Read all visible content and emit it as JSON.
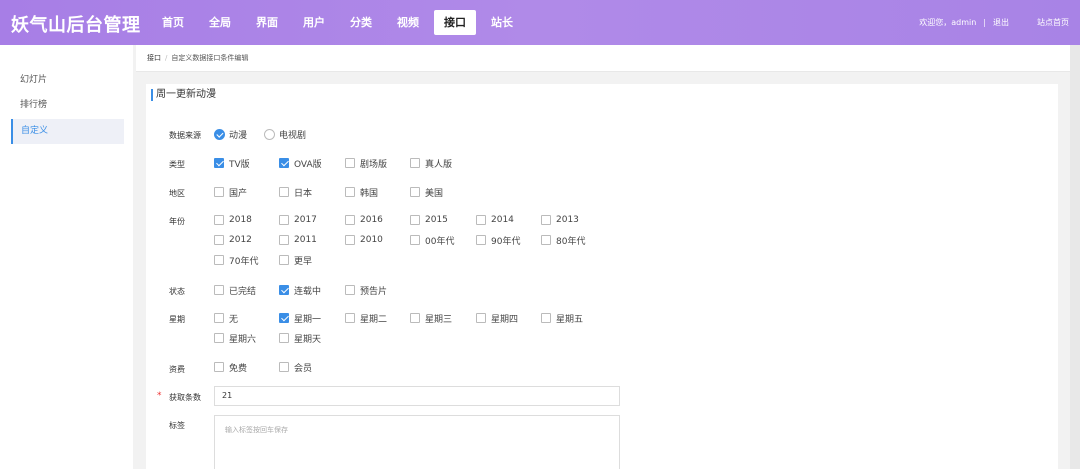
{
  "app": {
    "title": "妖气山后台管理"
  },
  "nav": [
    {
      "label": "首页"
    },
    {
      "label": "全局"
    },
    {
      "label": "界面"
    },
    {
      "label": "用户"
    },
    {
      "label": "分类"
    },
    {
      "label": "视频"
    },
    {
      "label": "接口",
      "active": true
    },
    {
      "label": "站长"
    }
  ],
  "top_right": {
    "welcome": "欢迎您，admin",
    "separator": "|",
    "logout": "退出",
    "site_home": "站点首页"
  },
  "sidebar": {
    "items": [
      {
        "label": "幻灯片"
      },
      {
        "label": "排行榜"
      },
      {
        "label": "自定义",
        "active": true
      }
    ]
  },
  "breadcrumb": {
    "root": "接口",
    "separator": "/",
    "current": "自定义数据接口条件编辑"
  },
  "card": {
    "title": "周一更新动漫"
  },
  "form": {
    "source": {
      "label": "数据来源",
      "options": [
        {
          "label": "动漫",
          "checked": true
        },
        {
          "label": "电视剧",
          "checked": false
        }
      ]
    },
    "type": {
      "label": "类型",
      "options": [
        {
          "label": "TV版",
          "checked": true
        },
        {
          "label": "OVA版",
          "checked": true
        },
        {
          "label": "剧场版",
          "checked": false
        },
        {
          "label": "真人版",
          "checked": false
        }
      ]
    },
    "region": {
      "label": "地区",
      "options": [
        {
          "label": "国产",
          "checked": false
        },
        {
          "label": "日本",
          "checked": false
        },
        {
          "label": "韩国",
          "checked": false
        },
        {
          "label": "美国",
          "checked": false
        }
      ]
    },
    "year": {
      "label": "年份",
      "options": [
        {
          "label": "2018",
          "checked": false
        },
        {
          "label": "2017",
          "checked": false
        },
        {
          "label": "2016",
          "checked": false
        },
        {
          "label": "2015",
          "checked": false
        },
        {
          "label": "2014",
          "checked": false
        },
        {
          "label": "2013",
          "checked": false
        },
        {
          "label": "2012",
          "checked": false
        },
        {
          "label": "2011",
          "checked": false
        },
        {
          "label": "2010",
          "checked": false
        },
        {
          "label": "00年代",
          "checked": false
        },
        {
          "label": "90年代",
          "checked": false
        },
        {
          "label": "80年代",
          "checked": false
        },
        {
          "label": "70年代",
          "checked": false
        },
        {
          "label": "更早",
          "checked": false
        }
      ]
    },
    "status": {
      "label": "状态",
      "options": [
        {
          "label": "已完结",
          "checked": false
        },
        {
          "label": "连载中",
          "checked": true
        },
        {
          "label": "预告片",
          "checked": false
        }
      ]
    },
    "weekday": {
      "label": "星期",
      "options": [
        {
          "label": "无",
          "checked": false
        },
        {
          "label": "星期一",
          "checked": true
        },
        {
          "label": "星期二",
          "checked": false
        },
        {
          "label": "星期三",
          "checked": false
        },
        {
          "label": "星期四",
          "checked": false
        },
        {
          "label": "星期五",
          "checked": false
        },
        {
          "label": "星期六",
          "checked": false
        },
        {
          "label": "星期天",
          "checked": false
        }
      ]
    },
    "fee": {
      "label": "资费",
      "options": [
        {
          "label": "免费",
          "checked": false
        },
        {
          "label": "会员",
          "checked": false
        }
      ]
    },
    "count": {
      "label": "获取条数",
      "required_mark": "*",
      "value": "21"
    },
    "tags": {
      "label": "标签",
      "placeholder": "输入标签按回车保存"
    }
  },
  "colors": {
    "header_gradient_start": "#a77ee6",
    "accent": "#3a8ee6"
  }
}
